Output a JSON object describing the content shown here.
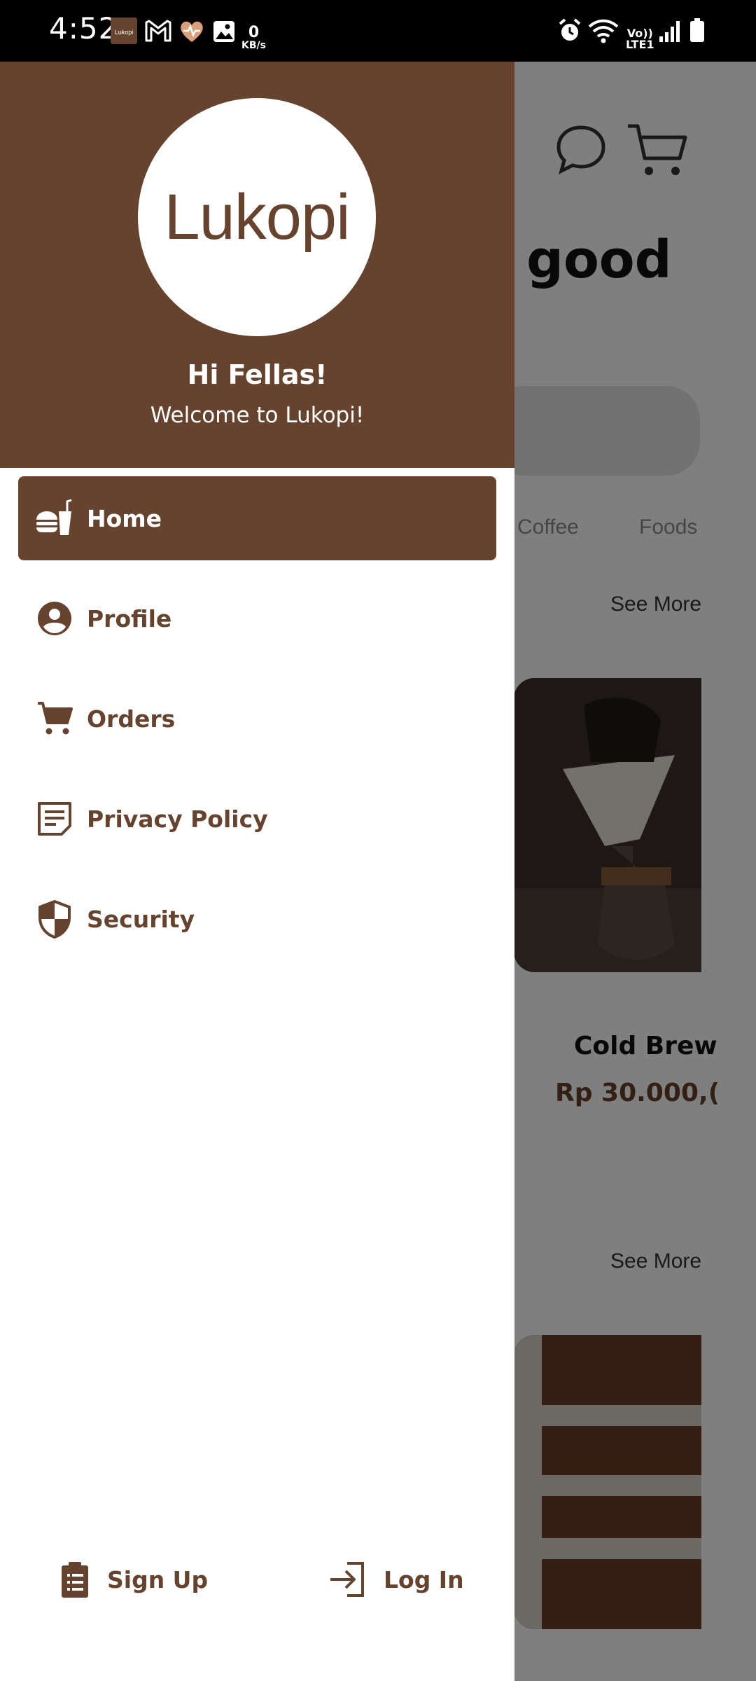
{
  "status_bar": {
    "time": "4:52",
    "net_speed_value": "0",
    "net_speed_unit": "KB/s",
    "notif_app_badge": "Lukopi",
    "volte_line1": "Vo))",
    "volte_line2": "LTE1"
  },
  "drawer": {
    "logo_text": "Lukopi",
    "greeting": "Hi Fellas!",
    "welcome": "Welcome to Lukopi!",
    "items": [
      {
        "label": "Home",
        "icon": "food-drink-icon",
        "active": true
      },
      {
        "label": "Profile",
        "icon": "account-circle-icon",
        "active": false
      },
      {
        "label": "Orders",
        "icon": "cart-icon",
        "active": false
      },
      {
        "label": "Privacy Policy",
        "icon": "document-icon",
        "active": false
      },
      {
        "label": "Security",
        "icon": "shield-icon",
        "active": false
      }
    ],
    "sign_up": "Sign Up",
    "log_in": "Log In"
  },
  "background": {
    "headline_fragment": "good",
    "categories": [
      "Coffee",
      "Foods"
    ],
    "see_more_1": "See More",
    "see_more_2": "See More",
    "product_name": "Cold Brew",
    "product_price": "Rp 30.000,("
  },
  "colors": {
    "brand": "#66432e",
    "overlay": "rgba(0,0,0,0.5)"
  }
}
